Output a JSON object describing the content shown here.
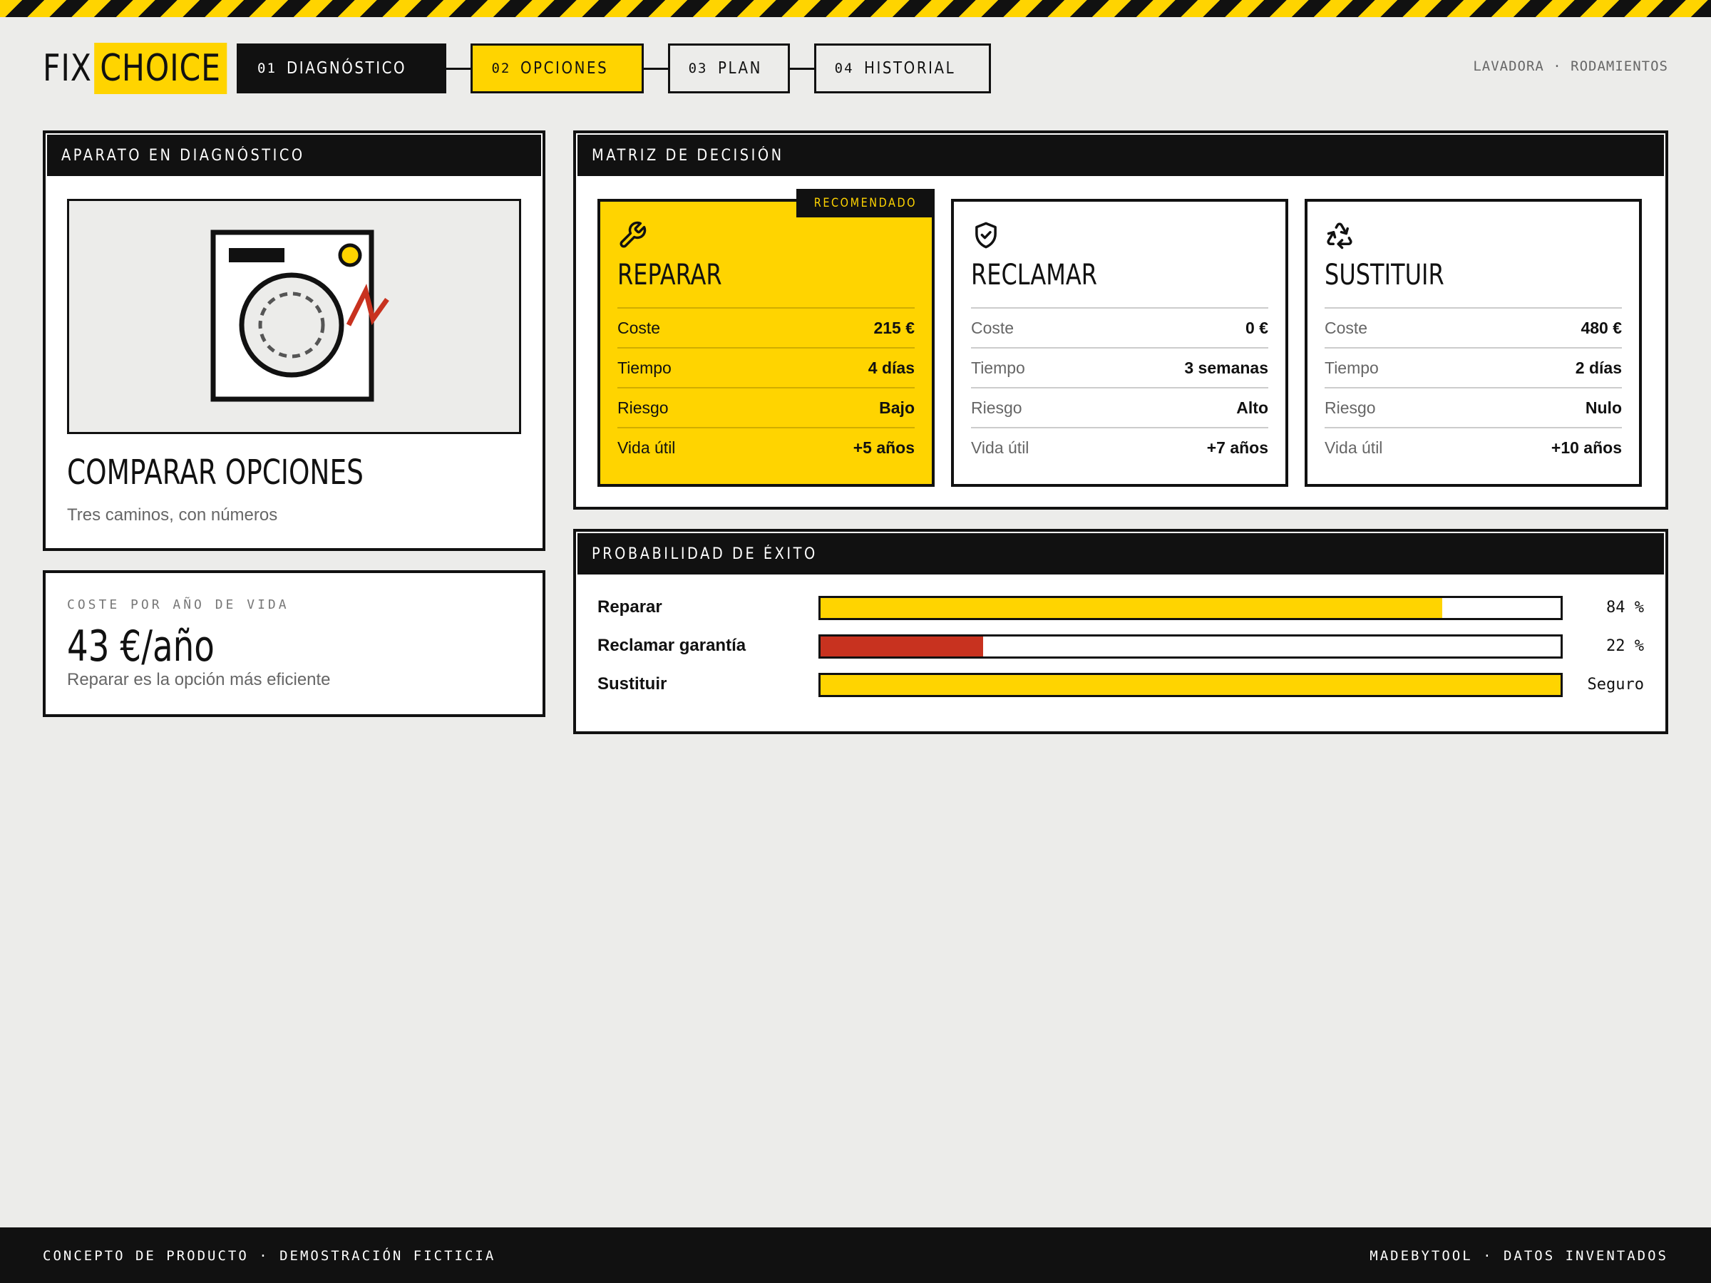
{
  "colors": {
    "accent": "#ffd400",
    "ink": "#111111",
    "danger": "#c8321f",
    "background": "#ececea"
  },
  "header": {
    "logo_left": "FIX",
    "logo_right": "CHOICE",
    "steps": [
      {
        "num": "01",
        "label": "DIAGNÓSTICO",
        "state": "done"
      },
      {
        "num": "02",
        "label": "OPCIONES",
        "state": "active"
      },
      {
        "num": "03",
        "label": "PLAN",
        "state": "pending"
      },
      {
        "num": "04",
        "label": "HISTORIAL",
        "state": "pending"
      }
    ],
    "breadcrumb": "LAVADORA · RODAMIENTOS"
  },
  "device_panel": {
    "heading": "APARATO EN DIAGNÓSTICO",
    "illustration": "washing-machine-icon",
    "title": "COMPARAR OPCIONES",
    "subtitle": "Tres caminos, con números"
  },
  "cost_panel": {
    "label": "COSTE POR AÑO DE VIDA",
    "value": "43 €/año",
    "note": "Reparar es la opción más eficiente"
  },
  "matrix_panel": {
    "heading": "MATRIZ DE DECISIÓN",
    "badge": "RECOMENDADO",
    "options": [
      {
        "title": "REPARAR",
        "icon": "wrench-icon",
        "recommended": true,
        "rows": [
          {
            "k": "Coste",
            "v": "215 €"
          },
          {
            "k": "Tiempo",
            "v": "4 días"
          },
          {
            "k": "Riesgo",
            "v": "Bajo"
          },
          {
            "k": "Vida útil",
            "v": "+5 años"
          }
        ]
      },
      {
        "title": "RECLAMAR",
        "icon": "shield-check-icon",
        "recommended": false,
        "rows": [
          {
            "k": "Coste",
            "v": "0 €"
          },
          {
            "k": "Tiempo",
            "v": "3 semanas"
          },
          {
            "k": "Riesgo",
            "v": "Alto"
          },
          {
            "k": "Vida útil",
            "v": "+7 años"
          }
        ]
      },
      {
        "title": "SUSTITUIR",
        "icon": "recycle-icon",
        "recommended": false,
        "rows": [
          {
            "k": "Coste",
            "v": "480 €"
          },
          {
            "k": "Tiempo",
            "v": "2 días"
          },
          {
            "k": "Riesgo",
            "v": "Nulo"
          },
          {
            "k": "Vida útil",
            "v": "+10 años"
          }
        ]
      }
    ]
  },
  "prob_panel": {
    "heading": "PROBABILIDAD DE ÉXITO",
    "rows": [
      {
        "label": "Reparar",
        "value": "84 %",
        "fraction": 0.84,
        "color": "#ffd400"
      },
      {
        "label": "Reclamar garantía",
        "value": "22 %",
        "fraction": 0.22,
        "color": "#c8321f"
      },
      {
        "label": "Sustituir",
        "value": "Seguro",
        "fraction": 1.0,
        "color": "#ffd400"
      }
    ]
  },
  "footer": {
    "left": "CONCEPTO DE PRODUCTO · DEMOSTRACIÓN FICTICIA",
    "right": "MADEBYTOOL · DATOS INVENTADOS"
  }
}
